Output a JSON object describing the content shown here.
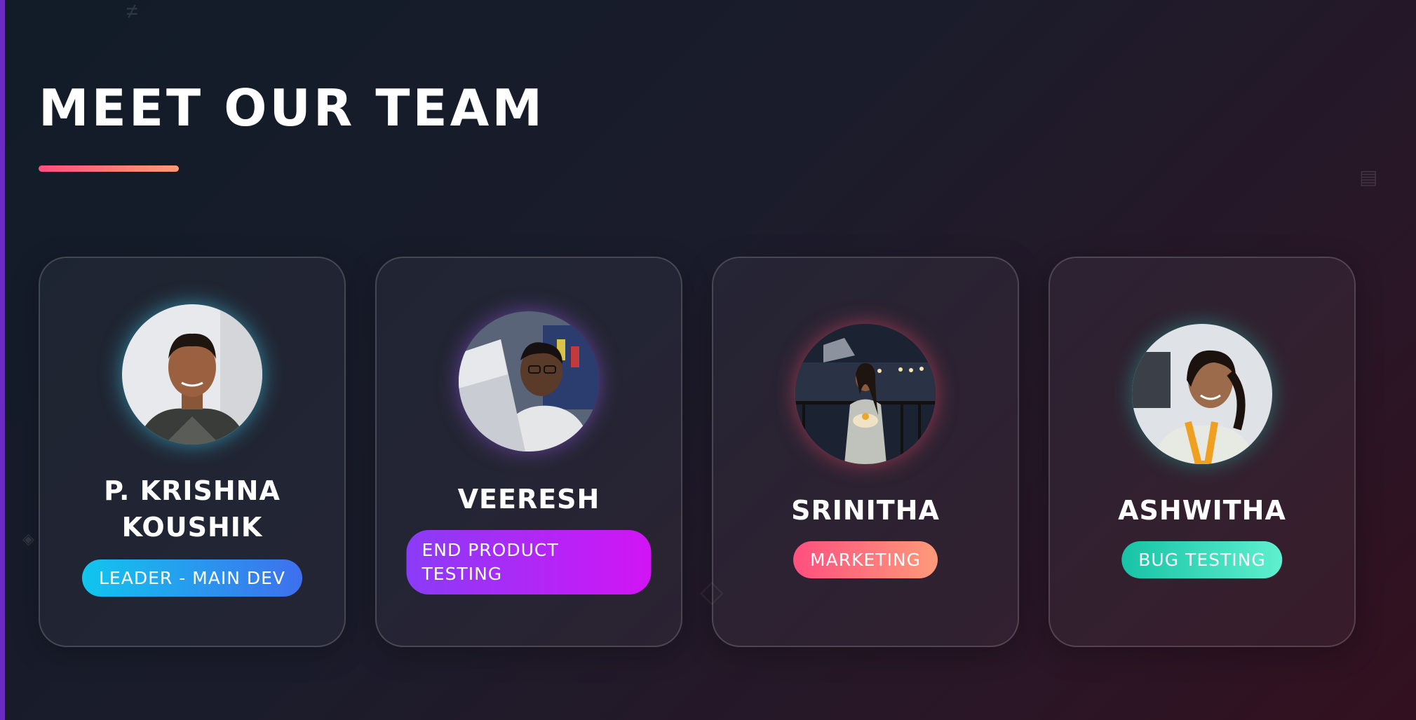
{
  "page": {
    "title": "MEET OUR TEAM"
  },
  "team": [
    {
      "name": "P. KRISHNA KOUSHIK",
      "role": "LEADER - MAIN DEV",
      "role_colors": [
        "#10c6ee",
        "#3f6fee"
      ],
      "avatar_icon": "person-photo"
    },
    {
      "name": "VEERESH",
      "role": "END PRODUCT TESTING",
      "role_colors": [
        "#8a3cf7",
        "#d214f5"
      ],
      "avatar_icon": "person-photo"
    },
    {
      "name": "SRINITHA",
      "role": "MARKETING",
      "role_colors": [
        "#ff4f7e",
        "#ff9a7a"
      ],
      "avatar_icon": "person-photo"
    },
    {
      "name": "ASHWITHA",
      "role": "BUG TESTING",
      "role_colors": [
        "#17c3a6",
        "#5ff0cf"
      ],
      "avatar_icon": "person-photo"
    }
  ],
  "colors": {
    "accent_underline": [
      "#ff4f7e",
      "#ff9a76"
    ],
    "left_bar": "#6a2bc0"
  }
}
